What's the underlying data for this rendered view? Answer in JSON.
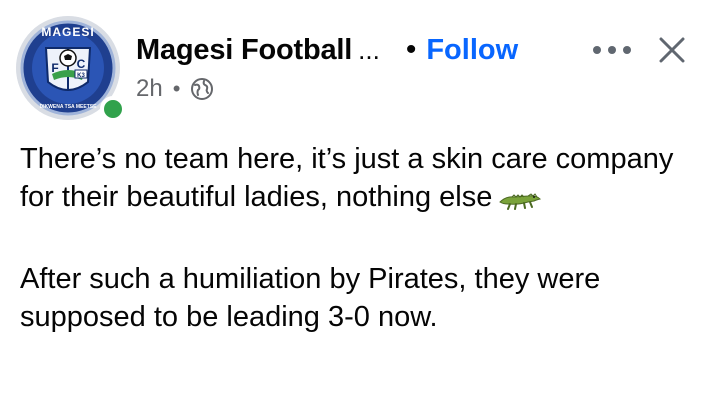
{
  "header": {
    "page_name": "Magesi Football",
    "name_truncation": "...",
    "separator": "•",
    "follow_label": "Follow",
    "time": "2h",
    "meta_separator": "•",
    "privacy_icon": "globe-icon",
    "more_icon": "more-horizontal-icon",
    "close_icon": "close-icon"
  },
  "avatar": {
    "logo_text_top": "MAGESI",
    "logo_letter_left": "F",
    "logo_letter_right": "C",
    "logo_badge": "K3",
    "logo_motto": "DIKWENA TSA MEETSE",
    "online": true
  },
  "post": {
    "paragraph_1": "There’s no team here, it’s just a skin care company for their beautiful ladies, nothing else",
    "paragraph_1_emoji": "crocodile-icon",
    "paragraph_2": "After such a humiliation by Pirates, they were supposed to be leading 3-0 now."
  },
  "colors": {
    "follow": "#0866ff",
    "secondary_text": "#65676b",
    "online": "#31a24c",
    "primary_text": "#050505"
  }
}
